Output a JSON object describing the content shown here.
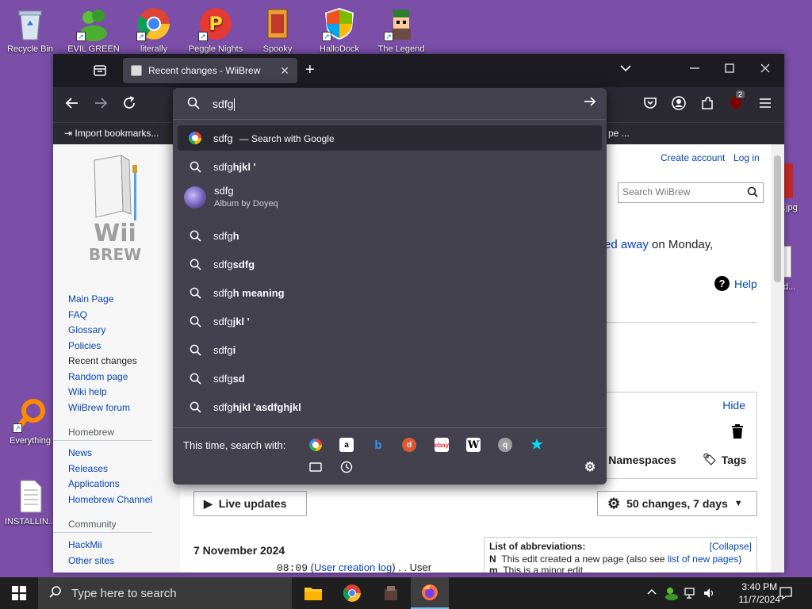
{
  "desktop": {
    "icons": [
      {
        "label": "Recycle Bin"
      },
      {
        "label": "EVIL GREEN"
      },
      {
        "label": "literally"
      },
      {
        "label": "Peggle Nights"
      },
      {
        "label": "Spooky"
      },
      {
        "label": "HalloDock"
      },
      {
        "label": "The Legend"
      },
      {
        "label": "Everything"
      },
      {
        "label": "INSTALLIN..."
      }
    ],
    "right_partial": [
      ".jpg",
      "d..."
    ]
  },
  "browser": {
    "tab_title": "Recent changes - WiiBrew",
    "bookmarks": {
      "import": "Import bookmarks...",
      "partial": "pe ..."
    },
    "extension_badge": "2"
  },
  "urlbar": {
    "value": "sdfg",
    "suggestions": [
      {
        "prefix": "sdfg",
        "bold": "",
        "extra": "— Search with Google",
        "icon": "google-icon",
        "selected": true
      },
      {
        "prefix": "sdfg",
        "bold": "hjkl '",
        "icon": "search-icon"
      },
      {
        "prefix": "sdfg",
        "bold": "",
        "subtitle": "Album by Doyeq",
        "icon": "album-art"
      },
      {
        "prefix": "sdfg",
        "bold": "h",
        "icon": "search-icon"
      },
      {
        "prefix": "sdfg",
        "bold": "sdfg",
        "icon": "search-icon"
      },
      {
        "prefix": "sdfg",
        "bold": "h meaning",
        "icon": "search-icon"
      },
      {
        "prefix": "sdfg",
        "bold": "jkl '",
        "icon": "search-icon"
      },
      {
        "prefix": "sdfg",
        "bold": "i",
        "icon": "search-icon"
      },
      {
        "prefix": "sdfg",
        "bold": "sd",
        "icon": "search-icon"
      },
      {
        "prefix": "sdfg",
        "bold": "hjkl 'asdfghjkl",
        "icon": "search-icon"
      }
    ],
    "search_with_label": "This time, search with:"
  },
  "wiki": {
    "sidebar": {
      "nav": [
        "Main Page",
        "FAQ",
        "Glossary",
        "Policies",
        "Recent changes",
        "Random page",
        "Wiki help",
        "WiiBrew forum"
      ],
      "homebrew_title": "Homebrew",
      "homebrew": [
        "News",
        "Releases",
        "Applications",
        "Homebrew Channel"
      ],
      "community_title": "Community",
      "community": [
        "HackMii",
        "Other sites"
      ]
    },
    "create_account": "Create account",
    "log_in": "Log in",
    "search_placeholder": "Search WiiBrew",
    "notice_link": "ssed away",
    "notice_text": " on Monday,",
    "help": "Help",
    "hide": "Hide",
    "namespaces": "Namespaces",
    "tags": "Tags",
    "live_updates": "Live updates",
    "changes_filter": "50 changes, 7 days",
    "date_heading": "7 November 2024",
    "entry": {
      "time": "08:09",
      "link": "User creation log",
      "rest": ". . User"
    },
    "abbrev": {
      "title": "List of abbreviations:",
      "collapse": "[Collapse]",
      "n_key": "N",
      "n_text": "This edit created a new page (also see ",
      "n_link": "list of new pages",
      "n_close": ")",
      "m_key": "m",
      "m_text": "This is a minor edit"
    }
  },
  "taskbar": {
    "search_placeholder": "Type here to search",
    "time": "3:40 PM",
    "date": "11/7/2024"
  }
}
